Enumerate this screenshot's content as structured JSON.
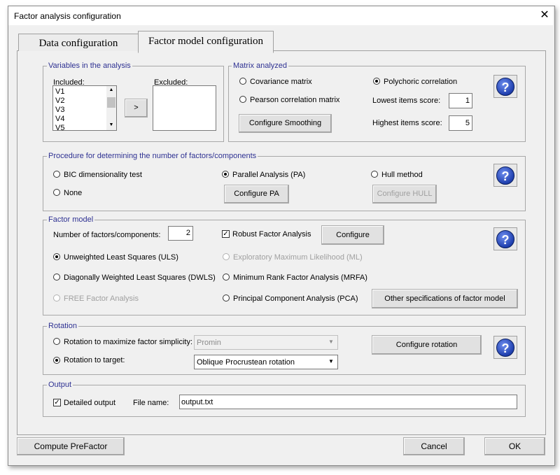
{
  "window": {
    "title": "Factor analysis configuration",
    "close_glyph": "✕"
  },
  "tabs": {
    "data": "Data configuration",
    "factor": "Factor model configuration"
  },
  "variables": {
    "group": "Variables in the analysis",
    "included_label": "Included:",
    "excluded_label": "Excluded:",
    "included_items": [
      "V1",
      "V2",
      "V3",
      "V4",
      "V5"
    ],
    "move_button": ">"
  },
  "matrix": {
    "group": "Matrix analyzed",
    "covariance": "Covariance matrix",
    "pearson": "Pearson correlation matrix",
    "polychoric": "Polychoric correlation",
    "lowest_label": "Lowest items score:",
    "lowest_value": "1",
    "highest_label": "Highest items score:",
    "highest_value": "5",
    "smoothing_button": "Configure Smoothing",
    "selected": "polychoric"
  },
  "procedure": {
    "group": "Procedure for determining the number of factors/components",
    "bic": "BIC dimensionality test",
    "none": "None",
    "pa": "Parallel Analysis (PA)",
    "hull": "Hull method",
    "configure_pa": "Configure PA",
    "configure_hull": "Configure HULL",
    "selected": "pa"
  },
  "factor_model": {
    "group": "Factor model",
    "num_label": "Number of factors/components:",
    "num_value": "2",
    "robust": "Robust Factor Analysis",
    "robust_checked": true,
    "configure": "Configure",
    "uls": "Unweighted Least Squares (ULS)",
    "dwls": "Diagonally Weighted Least Squares (DWLS)",
    "free": "FREE Factor Analysis",
    "ml": "Exploratory Maximum Likelihood (ML)",
    "mrfa": "Minimum Rank Factor Analysis (MRFA)",
    "pca": "Principal Component Analysis (PCA)",
    "other_specs": "Other specifications of factor model",
    "selected": "uls"
  },
  "rotation": {
    "group": "Rotation",
    "simplicity": "Rotation to maximize factor simplicity:",
    "simplicity_value": "Promin",
    "target": "Rotation to target:",
    "target_value": "Oblique Procrustean rotation",
    "configure": "Configure rotation",
    "selected": "target"
  },
  "output": {
    "group": "Output",
    "detailed": "Detailed output",
    "detailed_checked": true,
    "file_label": "File name:",
    "file_value": "output.txt"
  },
  "footer": {
    "compute": "Compute PreFactor",
    "cancel": "Cancel",
    "ok": "OK"
  },
  "help_glyph": "?",
  "check_glyph": "✓",
  "dropdown_glyph": "▼",
  "scroll_up_glyph": "▲",
  "scroll_down_glyph": "▼"
}
